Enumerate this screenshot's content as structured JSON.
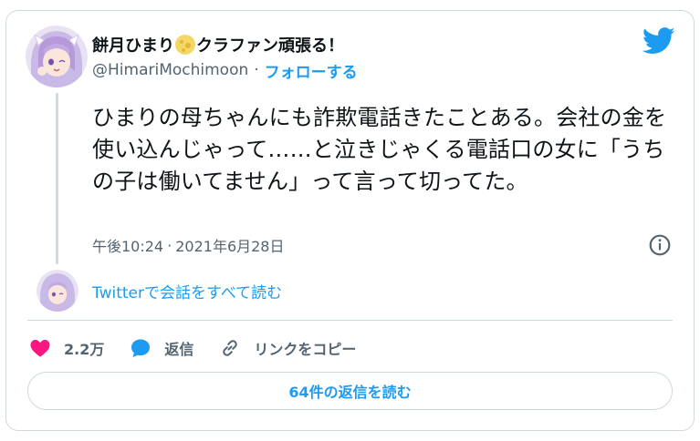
{
  "user": {
    "display_name": "餅月ひまり",
    "display_name_suffix": "クラファン頑張る！",
    "emoji_icon": "moon-emoji-icon",
    "handle": "@HimariMochimoon",
    "separator": "·",
    "follow_label": "フォローする"
  },
  "tweet": {
    "text": "ひまりの母ちゃんにも詐欺電話きたことある。会社の金を使い込んじゃって……と泣きじゃくる電話口の女に「うちの子は働いてません」って言って切ってた。",
    "time": "午後10:24",
    "separator": "·",
    "date": "2021年6月28日"
  },
  "read_conversation_label": "Twitterで会話をすべて読む",
  "actions": {
    "likes": "2.2万",
    "reply_label": "返信",
    "copy_link_label": "リンクをコピー"
  },
  "read_replies_label": "64件の返信を読む",
  "colors": {
    "accent": "#1d9bf0",
    "like": "#f91880",
    "border": "#cfd9de",
    "secondary_text": "#536471"
  }
}
